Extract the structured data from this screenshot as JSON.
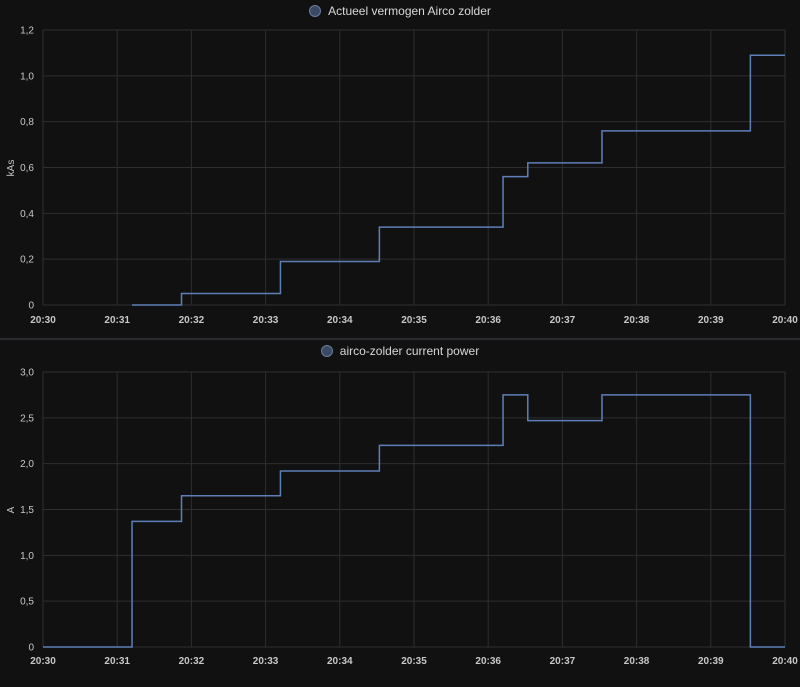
{
  "colors": {
    "background": "#111111",
    "grid": "#2d2e32",
    "series": "#5f7fb8",
    "text": "#c7c8ca"
  },
  "chart_data": [
    {
      "type": "line",
      "step": true,
      "legend": "Actueel vermogen Airco zolder",
      "legend_position": "top-center",
      "ylabel": "kAs",
      "xlabel": "",
      "grid": true,
      "x_ticks": [
        "20:30",
        "20:31",
        "20:32",
        "20:33",
        "20:34",
        "20:35",
        "20:36",
        "20:37",
        "20:38",
        "20:39",
        "20:40"
      ],
      "y_ticks": [
        "0",
        "0,2",
        "0,4",
        "0,6",
        "0,8",
        "1,0",
        "1,2"
      ],
      "xlim": [
        "20:30:00",
        "20:40:00"
      ],
      "ylim": [
        0,
        1.2
      ],
      "series": [
        {
          "name": "Actueel vermogen Airco zolder",
          "x": [
            "20:31:12",
            "20:31:52",
            "20:33:12",
            "20:34:32",
            "20:36:12",
            "20:36:32",
            "20:37:32",
            "20:39:32",
            "20:40:00"
          ],
          "y": [
            0,
            0.05,
            0.19,
            0.34,
            0.56,
            0.62,
            0.76,
            1.09,
            1.09
          ]
        }
      ]
    },
    {
      "type": "line",
      "step": true,
      "legend": "airco-zolder current power",
      "legend_position": "top-center",
      "ylabel": "A",
      "xlabel": "",
      "grid": true,
      "x_ticks": [
        "20:30",
        "20:31",
        "20:32",
        "20:33",
        "20:34",
        "20:35",
        "20:36",
        "20:37",
        "20:38",
        "20:39",
        "20:40"
      ],
      "y_ticks": [
        "0",
        "0,5",
        "1,0",
        "1,5",
        "2,0",
        "2,5",
        "3,0"
      ],
      "xlim": [
        "20:30:00",
        "20:40:00"
      ],
      "ylim": [
        0,
        3.0
      ],
      "series": [
        {
          "name": "airco-zolder current power",
          "x": [
            "20:30:00",
            "20:31:12",
            "20:31:52",
            "20:33:12",
            "20:34:32",
            "20:36:12",
            "20:36:32",
            "20:37:32",
            "20:39:32",
            "20:40:00"
          ],
          "y": [
            0,
            1.37,
            1.65,
            1.92,
            2.2,
            2.75,
            2.47,
            2.75,
            0,
            0
          ]
        }
      ]
    }
  ]
}
